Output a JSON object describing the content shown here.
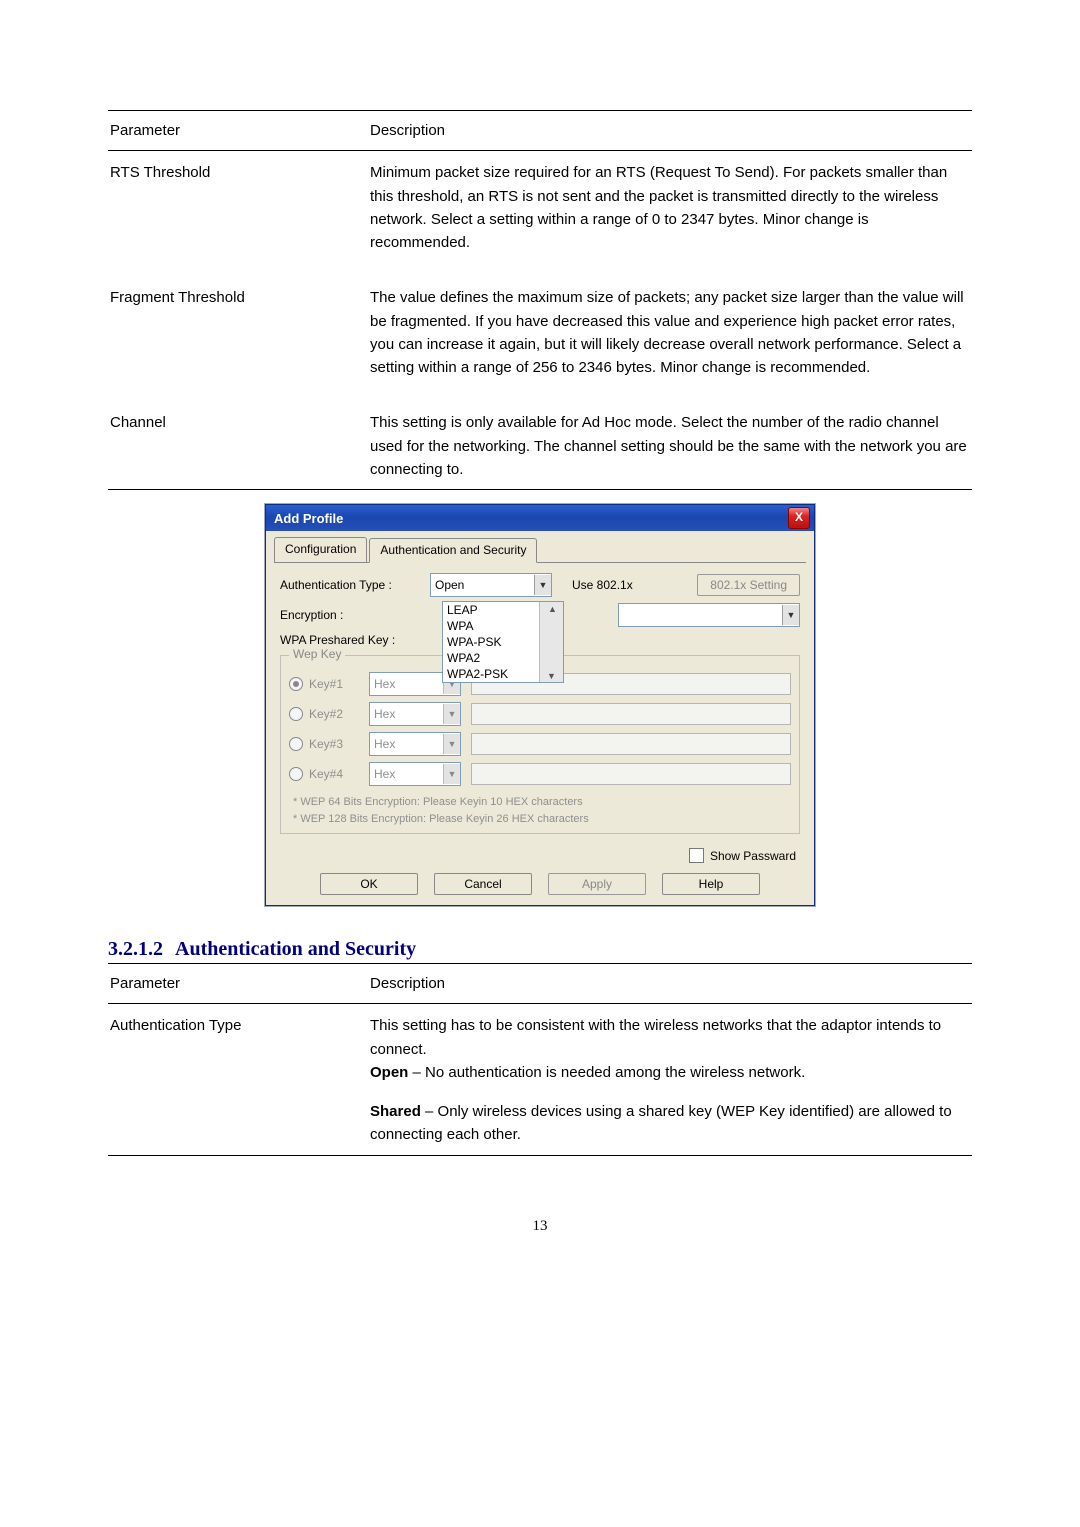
{
  "table1": {
    "headers": {
      "param": "Parameter",
      "desc": "Description"
    },
    "rows": [
      {
        "param": "RTS Threshold",
        "desc": "Minimum packet size required for an RTS (Request To Send). For packets smaller than this threshold, an RTS is not sent and the packet is transmitted directly to the wireless network. Select a setting within a range of 0 to 2347 bytes. Minor change is recommended."
      },
      {
        "param": "Fragment Threshold",
        "desc": "The value defines the maximum size of packets; any packet size larger than the value will be fragmented. If you have decreased this value and experience high packet error rates, you can increase it again, but it will likely decrease overall network performance. Select a setting within a range of 256 to 2346 bytes. Minor change is recommended."
      },
      {
        "param": "Channel",
        "desc": "This setting is only available for Ad Hoc mode. Select the number of the radio channel used for the networking. The channel setting should be the same with the network you are connecting to."
      }
    ]
  },
  "section2": {
    "number": "3.2.1.2",
    "title": "Authentication and Security"
  },
  "table2": {
    "headers": {
      "param": "Parameter",
      "desc": "Description"
    },
    "row_param": "Authentication Type",
    "desc_line1": "This setting has to be consistent with the wireless networks that the adaptor intends to connect.",
    "open_bold": "Open",
    "open_rest": " – No authentication is needed among the wireless network.",
    "shared_bold": "Shared",
    "shared_rest": " – Only wireless devices using a shared key (WEP Key identified) are allowed to connecting each other."
  },
  "dialog": {
    "title": "Add Profile",
    "close": "X",
    "tabs": {
      "config": "Configuration",
      "auth": "Authentication and Security"
    },
    "labels": {
      "auth_type": "Authentication Type :",
      "encryption": "Encryption :",
      "wpa_key": "WPA Preshared Key :"
    },
    "auth_combo_value": "Open",
    "auth_list": [
      "LEAP",
      "WPA",
      "WPA-PSK",
      "WPA2",
      "WPA2-PSK"
    ],
    "use_8021x": "Use 802.1x",
    "setting_btn": "802.1x Setting",
    "wep_group": "Wep Key",
    "wep_keys": [
      "Key#1",
      "Key#2",
      "Key#3",
      "Key#4"
    ],
    "hex": "Hex",
    "hint1": "* WEP 64 Bits Encryption:   Please Keyin 10 HEX characters",
    "hint2": "* WEP 128 Bits Encryption:   Please Keyin 26 HEX characters",
    "show_pwd": "Show Passward",
    "buttons": {
      "ok": "OK",
      "cancel": "Cancel",
      "apply": "Apply",
      "help": "Help"
    }
  },
  "page_number": "13"
}
